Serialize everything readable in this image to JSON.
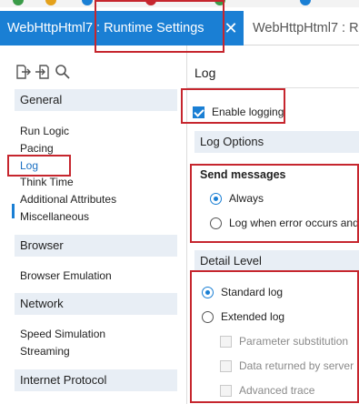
{
  "tabs": {
    "active_title": "WebHttpHtml7 : Runtime Settings",
    "inactive_title": "WebHttpHtml7 : R",
    "close_glyph": "✕"
  },
  "left_panel": {
    "toolbar": [
      "export-icon",
      "import-icon",
      "search-icon"
    ],
    "sections": [
      {
        "title": "General",
        "items": [
          "Run Logic",
          "Pacing",
          "Log",
          "Think Time",
          "Additional Attributes",
          "Miscellaneous"
        ]
      },
      {
        "title": "Browser",
        "items": [
          "Browser Emulation"
        ]
      },
      {
        "title": "Network",
        "items": [
          "Speed Simulation",
          "Streaming"
        ]
      },
      {
        "title": "Internet Protocol",
        "items": []
      }
    ],
    "selected_item": "Log"
  },
  "right_panel": {
    "title": "Log",
    "enable_logging": {
      "label": "Enable logging",
      "checked": true
    },
    "log_options_title": "Log Options",
    "send_messages": {
      "title": "Send messages",
      "options": [
        {
          "label": "Always",
          "selected": true
        },
        {
          "label": "Log when error occurs and",
          "selected": false
        }
      ]
    },
    "detail_level": {
      "title": "Detail Level",
      "options": [
        {
          "label": "Standard log",
          "selected": true
        },
        {
          "label": "Extended log",
          "selected": false
        }
      ],
      "sub_options": [
        {
          "label": "Parameter substitution",
          "checked": false,
          "enabled": false
        },
        {
          "label": "Data returned by server",
          "checked": false,
          "enabled": false
        },
        {
          "label": "Advanced trace",
          "checked": false,
          "enabled": false
        }
      ]
    }
  },
  "colors": {
    "accent": "#1a7fd4",
    "annotation": "#c6262e",
    "section_bg": "#e8eef5"
  }
}
